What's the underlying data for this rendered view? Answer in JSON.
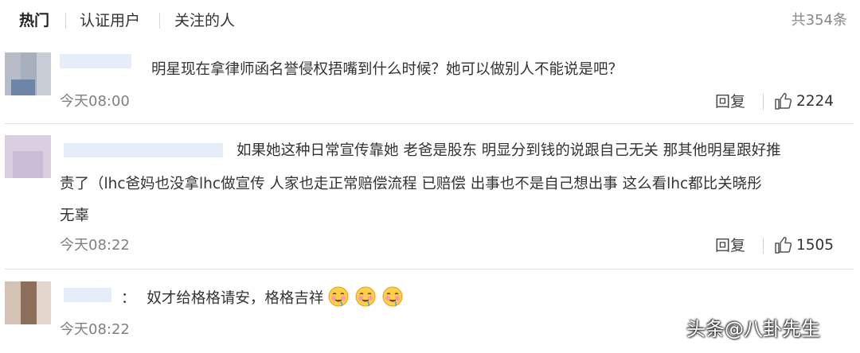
{
  "tabs": [
    {
      "label": "热门",
      "active": true
    },
    {
      "label": "认证用户",
      "active": false
    },
    {
      "label": "关注的人",
      "active": false
    }
  ],
  "total_count": "共354条",
  "comments": [
    {
      "content": "明星现在拿律师函名誉侵权捂嘴到什么时候？她可以做别人不能说是吧？",
      "time": "今天08:00",
      "reply_label": "回复",
      "likes": "2224"
    },
    {
      "content_lines": [
        "如果她这种日常宣传靠她 老爸是股东 明显分到钱的说跟自己无关 那其他明星跟好推",
        "责了（lhc爸妈也没拿lhc做宣传 人家也走正常赔偿流程 已赔偿 出事也不是自己想出事 这么看lhc都比关晓彤",
        "无辜"
      ],
      "time": "今天08:22",
      "reply_label": "回复",
      "likes": "1505"
    },
    {
      "prefix": "：",
      "content": "奴才给格格请安，格格吉祥",
      "emoji_count": 3,
      "emoji_icon": "drooling-face-emoji",
      "time": "今天08:22"
    }
  ],
  "watermark": "头条@八卦先生",
  "colors": {
    "username_placeholder": "#e5eef8",
    "muted_text": "#808080",
    "divider": "#e2e2e2"
  }
}
